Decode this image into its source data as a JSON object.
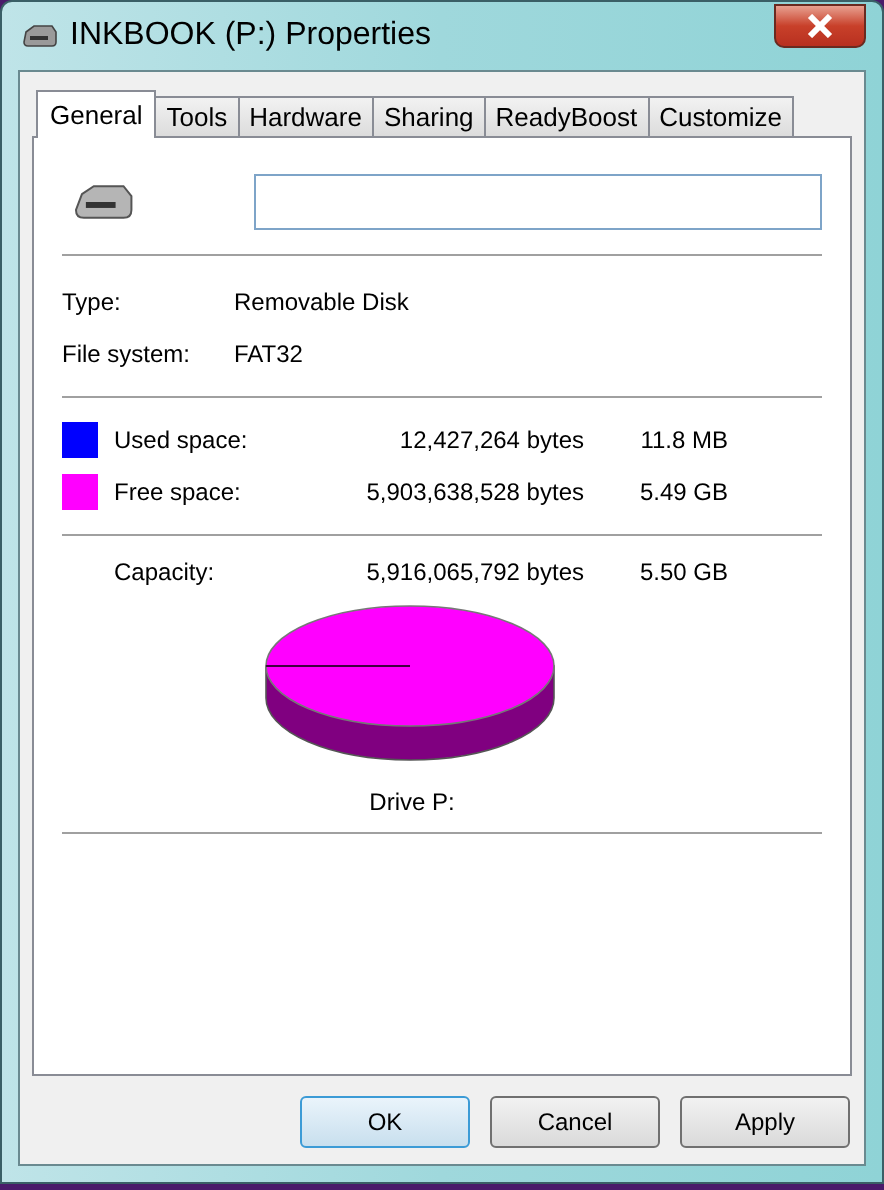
{
  "window": {
    "title": "INKBOOK (P:) Properties"
  },
  "tabs": [
    {
      "label": "General",
      "selected": true
    },
    {
      "label": "Tools",
      "selected": false
    },
    {
      "label": "Hardware",
      "selected": false
    },
    {
      "label": "Sharing",
      "selected": false
    },
    {
      "label": "ReadyBoost",
      "selected": false
    },
    {
      "label": "Customize",
      "selected": false
    }
  ],
  "info": [
    {
      "label": "Type:",
      "value": "Removable Disk"
    },
    {
      "label": "File system:",
      "value": "FAT32"
    }
  ],
  "usage": [
    {
      "label": "Used space:",
      "bytes": "12,427,264 bytes",
      "size": "11.8 MB",
      "color": "#0000ff"
    },
    {
      "label": "Free space:",
      "bytes": "5,903,638,528 bytes",
      "size": "5.49 GB",
      "color": "#ff00ff"
    }
  ],
  "capacity": {
    "label": "Capacity:",
    "bytes": "5,916,065,792 bytes",
    "size": "5.50 GB"
  },
  "drive_label": "Drive P:",
  "buttons": [
    {
      "label": "OK",
      "default": true
    },
    {
      "label": "Cancel",
      "default": false
    },
    {
      "label": "Apply",
      "default": false
    }
  ]
}
